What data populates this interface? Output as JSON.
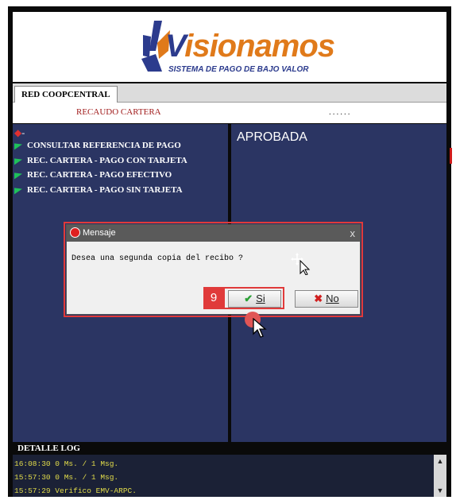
{
  "brand": {
    "name_v": "V",
    "name_rest": "isionamos",
    "tagline": "SISTEMA DE PAGO DE BAJO VALOR"
  },
  "tab": {
    "label": "RED COOPCENTRAL"
  },
  "subheader": {
    "title": "RECAUDO  CARTERA",
    "dots": "......"
  },
  "menu": {
    "top": "-",
    "items": [
      {
        "label": "CONSULTAR REFERENCIA DE PAGO"
      },
      {
        "label": "REC. CARTERA - PAGO CON TARJETA"
      },
      {
        "label": "REC. CARTERA - PAGO EFECTIVO"
      },
      {
        "label": "REC. CARTERA - PAGO SIN TARJETA"
      }
    ]
  },
  "status": {
    "text": "APROBADA"
  },
  "dialog": {
    "title": "Mensaje",
    "close": "x",
    "message": "Desea una segunda copia del recibo ?",
    "yes_label": "Si",
    "no_label": "No"
  },
  "step": {
    "number": "9"
  },
  "log": {
    "title": "DETALLE LOG",
    "lines": [
      "16:08:30 0 Ms. / 1 Msg.",
      "15:57:30 0 Ms. / 1 Msg.",
      "15:57:29 Verifico EMV-ARPC."
    ]
  },
  "colors": {
    "panel": "#2b3563",
    "accent_red": "#e03a3a",
    "log_text": "#e2dc4a",
    "brand_blue": "#2c3b8d",
    "brand_orange": "#e07a1a"
  }
}
